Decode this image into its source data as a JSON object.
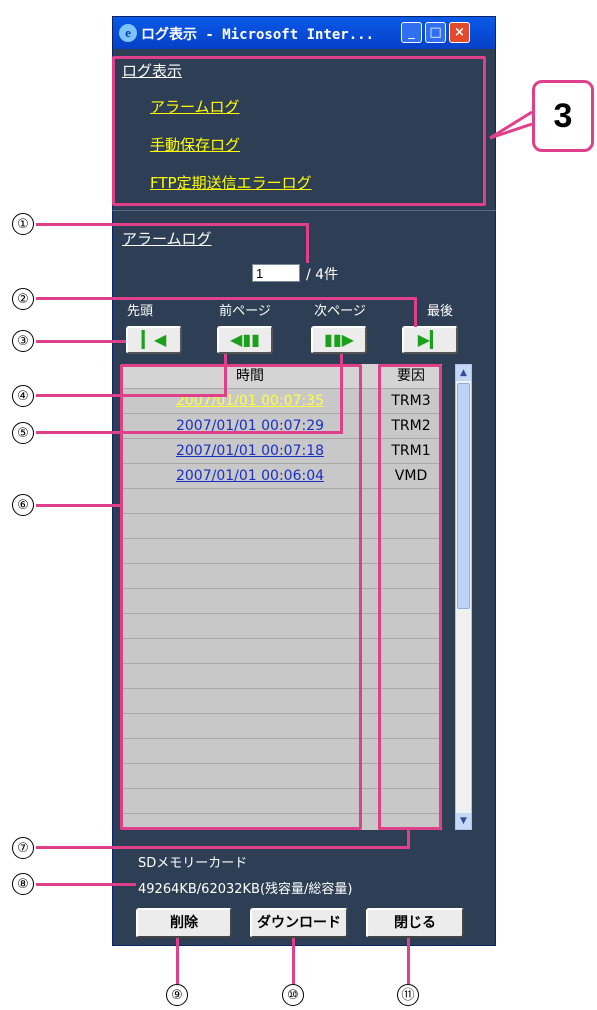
{
  "window": {
    "title": "ログ表示 - Microsoft Inter...",
    "minimize": "_",
    "maximize": "□",
    "close": "×"
  },
  "menu": {
    "title": "ログ表示",
    "links": [
      "アラームログ",
      "手動保存ログ",
      "FTP定期送信エラーログ"
    ]
  },
  "log": {
    "section_title": "アラームログ",
    "page_value": "1",
    "page_total": "/ 4件",
    "nav": [
      {
        "label": "先頭",
        "glyph": "▎◀"
      },
      {
        "label": "前ページ",
        "glyph": "◀▮▮"
      },
      {
        "label": "次ページ",
        "glyph": "▮▮▶"
      },
      {
        "label": "最後",
        "glyph": "▶▎"
      }
    ],
    "headers": {
      "time": "時間",
      "cause": "要因"
    },
    "rows": [
      {
        "time": "2007/01/01 00:07:35",
        "cause": "TRM3"
      },
      {
        "time": "2007/01/01 00:07:29",
        "cause": "TRM2"
      },
      {
        "time": "2007/01/01 00:07:18",
        "cause": "TRM1"
      },
      {
        "time": "2007/01/01 00:06:04",
        "cause": "VMD"
      }
    ]
  },
  "sd": {
    "label": "SDメモリーカード",
    "capacity": "49264KB/62032KB(残容量/総容量)"
  },
  "buttons": {
    "delete": "削除",
    "download": "ダウンロード",
    "close": "閉じる"
  },
  "callouts": {
    "big": "3",
    "numbers": [
      "①",
      "②",
      "③",
      "④",
      "⑤",
      "⑥",
      "⑦",
      "⑧",
      "⑨",
      "⑩",
      "⑪"
    ]
  },
  "colors": {
    "window_bg": "#2e3f55",
    "link_yellow": "#ffff00",
    "callout_pink": "#e0408a",
    "nav_icon_green": "#1aa01a"
  }
}
